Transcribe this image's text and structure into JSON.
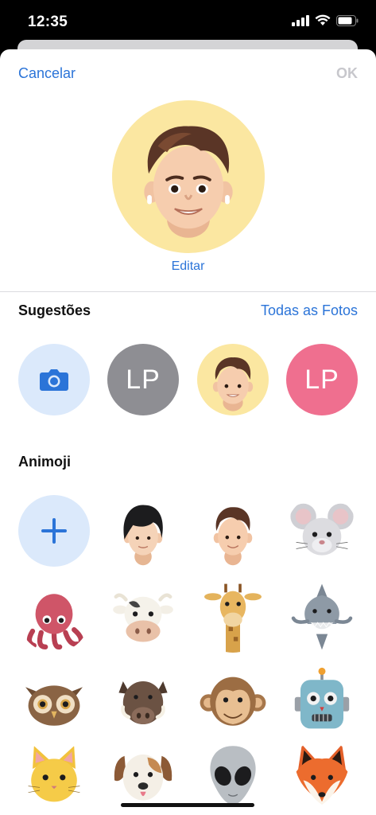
{
  "status_bar": {
    "time": "12:35"
  },
  "nav": {
    "cancel_label": "Cancelar",
    "ok_label": "OK"
  },
  "avatar": {
    "edit_label": "Editar"
  },
  "suggestions": {
    "title": "Sugestões",
    "all_photos_label": "Todas as Fotos",
    "items": [
      {
        "type": "camera",
        "icon": "camera-icon"
      },
      {
        "type": "monogram",
        "text": "LP",
        "color": "#8e8e93"
      },
      {
        "type": "memoji",
        "icon": "memoji-boy-icon"
      },
      {
        "type": "monogram",
        "text": "LP",
        "color": "#ef6f8f"
      }
    ]
  },
  "animoji": {
    "title": "Animoji",
    "items": [
      "add-icon",
      "memoji-black-hair-icon",
      "memoji-boy-icon",
      "mouse-icon",
      "octopus-icon",
      "cow-icon",
      "giraffe-icon",
      "shark-icon",
      "owl-icon",
      "boar-icon",
      "monkey-icon",
      "robot-icon",
      "cat-icon",
      "dog-icon",
      "alien-icon",
      "fox-icon"
    ]
  },
  "colors": {
    "accent": "#2b74d8",
    "avatar_background": "#fbe7a1",
    "camera_background": "#dbe9fb",
    "disabled": "#c7c7cc"
  }
}
